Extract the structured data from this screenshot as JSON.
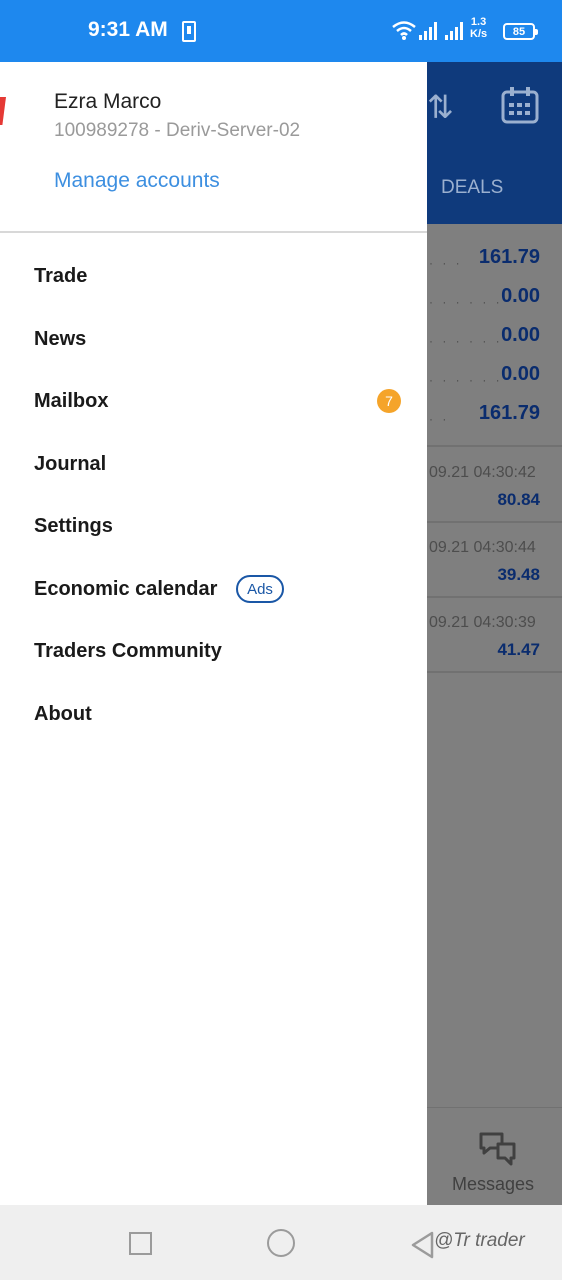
{
  "status_bar": {
    "time": "9:31 AM",
    "net_speed_value": "1.3",
    "net_speed_unit": "K/s",
    "battery": "85"
  },
  "background_app": {
    "header_tab": "DEALS",
    "summary_values": [
      "161.79",
      "0.00",
      "0.00",
      "0.00",
      "161.79"
    ],
    "deals": [
      {
        "time": "09.21 04:30:42",
        "profit": "80.84"
      },
      {
        "time": "09.21 04:30:44",
        "profit": "39.48"
      },
      {
        "time": "09.21 04:30:39",
        "profit": "41.47"
      }
    ],
    "messages_label": "Messages"
  },
  "drawer": {
    "account_name": "Ezra Marco",
    "account_server": "100989278 - Deriv-Server-02",
    "manage_accounts": "Manage accounts",
    "menu": [
      {
        "label": "Trade"
      },
      {
        "label": "News"
      },
      {
        "label": "Mailbox",
        "badge": "7"
      },
      {
        "label": "Journal"
      },
      {
        "label": "Settings"
      },
      {
        "label": "Economic calendar",
        "tag": "Ads"
      },
      {
        "label": "Traders Community"
      },
      {
        "label": "About"
      }
    ]
  },
  "watermark": "@Tr trader",
  "colors": {
    "status_bar": "#1e88ee",
    "link": "#3d8fe0",
    "badge": "#f5a42a",
    "app_header": "#0f3a7c"
  }
}
